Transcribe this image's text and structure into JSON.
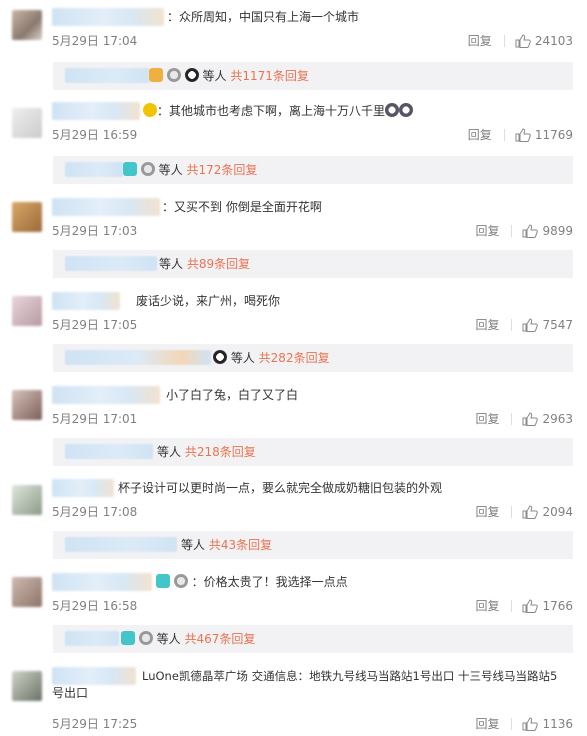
{
  "reply_label": "回复",
  "comments": [
    {
      "text": "：众所周知，中国只有上海一个城市",
      "date": "5月29日 17:04",
      "likes": "24103",
      "sub": {
        "suffix": "等人",
        "count": "共1171条回复"
      }
    },
    {
      "text": "：其他城市也考虑下啊，离上海十万八千里",
      "date": "5月29日 16:59",
      "likes": "11769",
      "sub": {
        "suffix": "等人",
        "count": "共172条回复"
      }
    },
    {
      "text": "：又买不到 你倒是全面开花啊",
      "date": "5月29日 17:03",
      "likes": "9899",
      "sub": {
        "suffix": "等人",
        "count": "共89条回复"
      }
    },
    {
      "text": "废话少说，来广州，喝死你",
      "date": "5月29日 17:05",
      "likes": "7547",
      "sub": {
        "suffix": "等人",
        "count": "共282条回复"
      }
    },
    {
      "text": "小了白了兔，白了又了白",
      "date": "5月29日 17:01",
      "likes": "2963",
      "sub": {
        "suffix": "等人",
        "count": "共218条回复"
      }
    },
    {
      "text": "杯子设计可以更时尚一点，要么就完全做成奶糖旧包装的外观",
      "date": "5月29日 17:08",
      "likes": "2094",
      "sub": {
        "suffix": "等人",
        "count": "共43条回复"
      }
    },
    {
      "text": "：价格太贵了！我选择一点点",
      "date": "5月29日 16:58",
      "likes": "1766",
      "sub": {
        "suffix": "等人",
        "count": "共467条回复"
      }
    },
    {
      "text": "LuOne凯德晶萃广场 交通信息：地铁九号线马当路站1号出口 十三号线马当路站5",
      "text2": "号出口",
      "date": "5月29日 17:25",
      "likes": "1136"
    }
  ]
}
